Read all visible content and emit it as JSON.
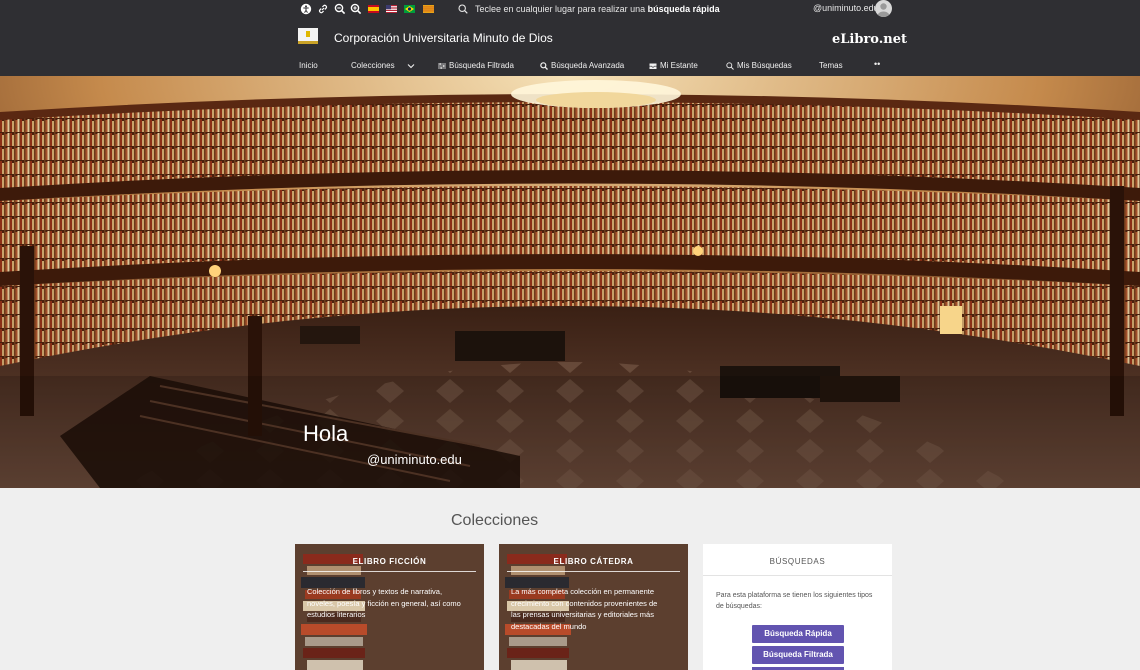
{
  "header": {
    "quick_search_text": "Teclee en cualquier lugar para realizar una",
    "quick_search_bold": "búsqueda rápida",
    "user": "@uniminuto.edu",
    "institution": "Corporación Universitaria Minuto de Dios",
    "brand": "eLibro.net"
  },
  "nav": {
    "inicio": "Inicio",
    "colecciones": "Colecciones",
    "busqueda_filtrada": "Búsqueda Filtrada",
    "busqueda_avanzada": "Búsqueda Avanzada",
    "mi_estante": "Mi Estante",
    "mis_busquedas": "Mis Búsquedas",
    "temas": "Temas",
    "more": "••"
  },
  "hero": {
    "greeting": "Hola",
    "user": "@uniminuto.edu"
  },
  "collections": {
    "title": "Colecciones",
    "cards": [
      {
        "title": "ELIBRO FICCIÓN",
        "desc": "Colección de libros y textos de narrativa, noveles, poesía y ficción en general, así como estudios literarios"
      },
      {
        "title": "ELIBRO CÁTEDRA",
        "desc": "La más completa colección en permanente crecimiento con contenidos provenientes de las prensas universitarias y editoriales más destacadas del mundo"
      }
    ],
    "panel": {
      "title": "BÚSQUEDAS",
      "desc": "Para esta plataforma se tienen los siguientes tipos de búsquedas:",
      "buttons": [
        "Búsqueda Rápida",
        "Búsqueda Filtrada"
      ]
    }
  },
  "colors": {
    "header_bg": "#2f2f33",
    "button_purple": "#6254b0",
    "page_bg": "#efefef"
  }
}
